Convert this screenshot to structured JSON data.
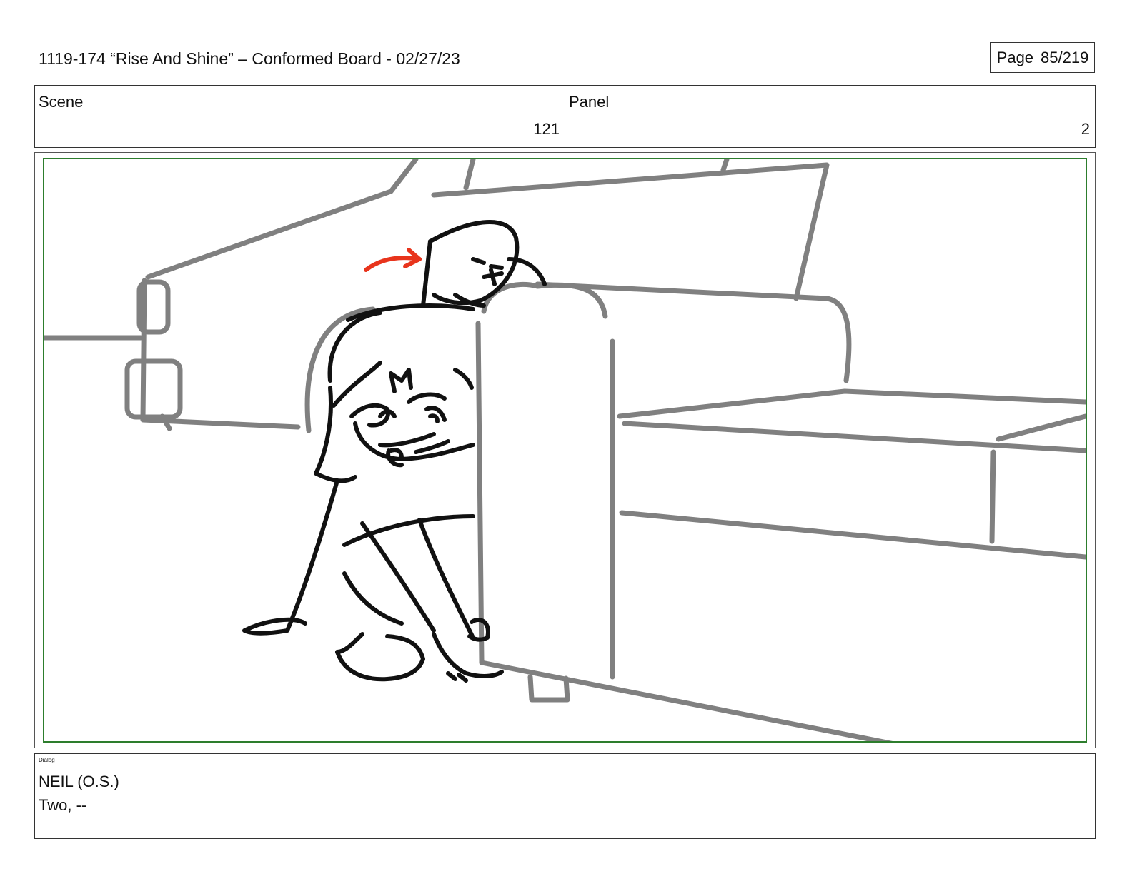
{
  "header": {
    "title": "1119-174 “Rise And Shine” – Conformed Board - 02/27/23",
    "page_label": "Page",
    "page_number": "85/219"
  },
  "scene": {
    "label": "Scene",
    "value": "121"
  },
  "panel": {
    "label": "Panel",
    "value": "2"
  },
  "dialog": {
    "label": "Dialog",
    "speaker": "NEIL (O.S.)",
    "line": "Two, --"
  },
  "colors": {
    "safe_area_border": "#2d7d2d",
    "background_lines": "#808080",
    "character_lines": "#111111",
    "action_arrow": "#e8341c"
  }
}
